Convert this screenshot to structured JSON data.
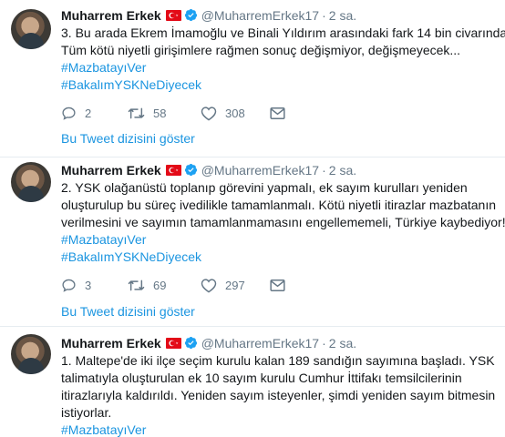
{
  "colors": {
    "link": "#1b95e0",
    "text": "#14171a",
    "muted": "#657786",
    "divider": "#e6ecf0",
    "verified": "#1da1f2",
    "flag": "#e30a17"
  },
  "tweets": [
    {
      "author_name": "Muharrem Erkek",
      "handle": "@MuharremErkek17",
      "separator": "·",
      "time": "2 sa.",
      "lines": [
        "3. Bu arada Ekrem İmamoğlu ve Binali Yıldırım arasındaki fark 14 bin civarında.",
        "Tüm kötü niyetli girişimlere rağmen sonuç değişmiyor, değişmeyecek..."
      ],
      "hashtags": [
        "#MazbatayıVer",
        "#BakalımYSKNeDiyecek"
      ],
      "replies": "2",
      "retweets": "58",
      "likes": "308",
      "thread_link": "Bu Tweet dizisini göster"
    },
    {
      "author_name": "Muharrem Erkek",
      "handle": "@MuharremErkek17",
      "separator": "·",
      "time": "2 sa.",
      "lines": [
        "2. YSK olağanüstü toplanıp görevini yapmalı, ek sayım kurulları yeniden",
        "oluşturulup bu süreç ivedilikle tamamlanmalı. Kötü niyetli itirazlar mazbatanın",
        "verilmesini ve sayımın tamamlanmamasını engellememeli, Türkiye kaybediyor!"
      ],
      "hashtags": [
        "#MazbatayıVer",
        "#BakalımYSKNeDiyecek"
      ],
      "replies": "3",
      "retweets": "69",
      "likes": "297",
      "thread_link": "Bu Tweet dizisini göster"
    },
    {
      "author_name": "Muharrem Erkek",
      "handle": "@MuharremErkek17",
      "separator": "·",
      "time": "2 sa.",
      "lines": [
        "1. Maltepe'de iki ilçe seçim kurulu kalan 189 sandığın sayımına başladı. YSK",
        "talimatıyla oluşturulan ek 10 sayım kurulu Cumhur İttifakı temsilcilerinin",
        "itirazlarıyla kaldırıldı. Yeniden sayım isteyenler, şimdi yeniden sayım bitmesin",
        "istiyorlar."
      ],
      "hashtags": [
        "#MazbatayıVer"
      ]
    }
  ]
}
